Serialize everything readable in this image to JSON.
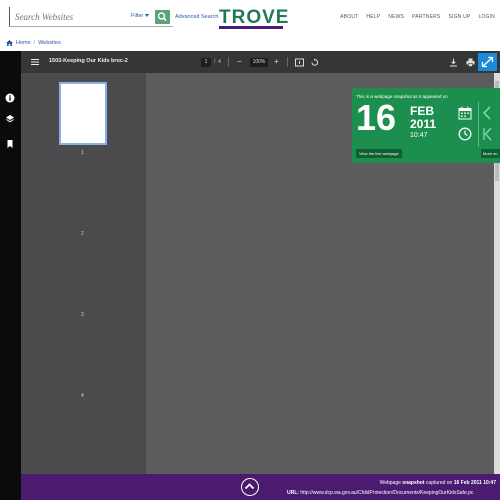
{
  "header": {
    "search_placeholder": "Search Websites",
    "filter_label": "Filter",
    "advanced_search": "Advanced Search",
    "logo_text": "TROVE",
    "nav": [
      "ABOUT",
      "HELP",
      "NEWS",
      "PARTNERS",
      "SIGN UP",
      "LOGIN"
    ]
  },
  "breadcrumb": {
    "home": "Home",
    "separator": "/",
    "current": "Websites"
  },
  "viewer": {
    "title": "1503-Keeping Our Kids broc-2",
    "current_page": "1",
    "page_sep": "/",
    "total_pages": "4",
    "zoom": "100%",
    "zoom_out": "−",
    "zoom_in": "+",
    "thumbnails": [
      "1",
      "2",
      "3",
      "4"
    ]
  },
  "snapshot": {
    "heading": "This is a webpage snapshot as it appeared on",
    "day": "16",
    "month": "FEB",
    "year": "2011",
    "time": "10:47",
    "view_live": "View the live webpage",
    "more": "More sn"
  },
  "footer": {
    "line1_prefix": "Webpage",
    "line1_bold": "snapshot",
    "line1_mid": "captured on",
    "line1_date": "16 Feb 2011 10:47",
    "url_label": "URL:",
    "url": "http://www.dcp.wa.gov.au/ChildProtection/Documents/KeepingOurKidsSafe.pc"
  },
  "colors": {
    "brand_green": "#1f7a52",
    "brand_purple": "#4b1d7a",
    "link_blue": "#2a5aa6",
    "banner_green": "#1c8f4f",
    "viewer_bg": "#4b4b4d",
    "accent_blue": "#1c8ad8"
  }
}
